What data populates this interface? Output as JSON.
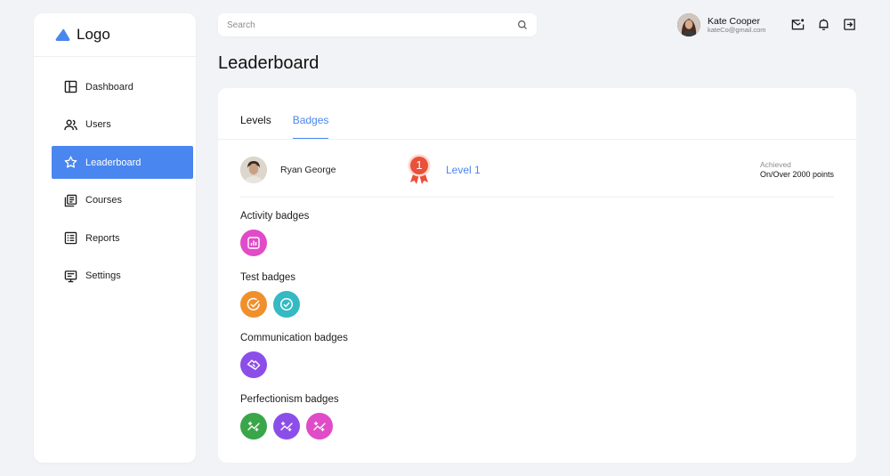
{
  "sidebar": {
    "logo_text": "Logo",
    "items": [
      {
        "label": "Dashboard",
        "icon": "dashboard-icon"
      },
      {
        "label": "Users",
        "icon": "users-icon"
      },
      {
        "label": "Leaderboard",
        "icon": "star-icon",
        "active": true
      },
      {
        "label": "Courses",
        "icon": "courses-icon"
      },
      {
        "label": "Reports",
        "icon": "reports-icon"
      },
      {
        "label": "Settings",
        "icon": "settings-icon"
      }
    ]
  },
  "search": {
    "placeholder": "Search"
  },
  "user": {
    "name": "Kate Cooper",
    "email": "kateCo@gmail.com"
  },
  "page": {
    "title": "Leaderboard"
  },
  "tabs": [
    {
      "label": "Levels",
      "active": false
    },
    {
      "label": "Badges",
      "active": true
    }
  ],
  "profile": {
    "name": "Ryan George",
    "medal_number": "1",
    "level": "Level 1",
    "achieved_label": "Achieved",
    "achieved_value": "On/Over 2000 points"
  },
  "badge_groups": [
    {
      "title": "Activity badges",
      "badges": [
        {
          "icon": "chart-icon",
          "color": "#e04bc8"
        }
      ]
    },
    {
      "title": "Test badges",
      "badges": [
        {
          "icon": "check-circle-icon",
          "color": "#f0902c"
        },
        {
          "icon": "check-circle-icon",
          "color": "#35b9c2"
        }
      ]
    },
    {
      "title": "Communication badges",
      "badges": [
        {
          "icon": "handshake-icon",
          "color": "#8c4ee8"
        }
      ]
    },
    {
      "title": "Perfectionism badges",
      "badges": [
        {
          "icon": "sparkle-trend-icon",
          "color": "#3aa64a"
        },
        {
          "icon": "sparkle-trend-icon",
          "color": "#8c4ee8"
        },
        {
          "icon": "sparkle-trend-icon",
          "color": "#e04bc8"
        }
      ]
    }
  ],
  "colors": {
    "accent": "#4a86f0",
    "medal": "#e9513a"
  }
}
